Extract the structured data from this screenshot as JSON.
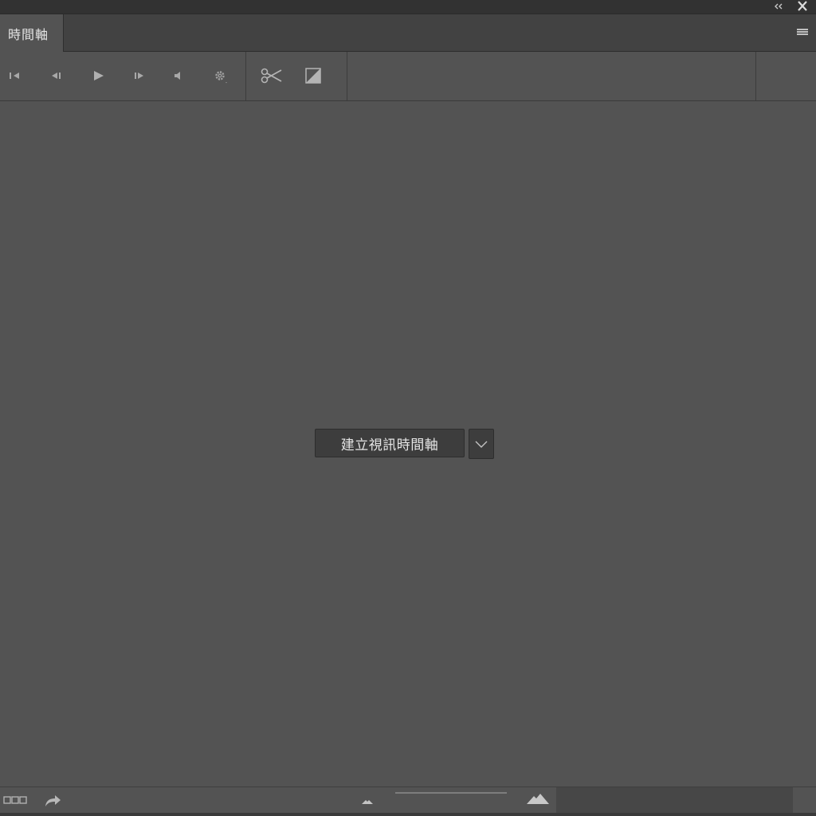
{
  "window": {
    "collapse_icon": "double-chevron-left-icon",
    "close_icon": "close-icon"
  },
  "tab": {
    "label": "時間軸"
  },
  "panel_menu_icon": "hamburger-menu-icon",
  "toolbar": {
    "buttons": [
      {
        "name": "go-to-first-frame",
        "icon": "skip-to-start-icon"
      },
      {
        "name": "previous-frame",
        "icon": "step-back-icon"
      },
      {
        "name": "play",
        "icon": "play-icon"
      },
      {
        "name": "next-frame",
        "icon": "step-forward-icon"
      },
      {
        "name": "audio",
        "icon": "speaker-icon"
      },
      {
        "name": "settings",
        "icon": "gear-icon"
      },
      {
        "name": "split-at-playhead",
        "icon": "scissors-icon"
      },
      {
        "name": "transition",
        "icon": "transition-icon"
      }
    ]
  },
  "create_button": {
    "label": "建立視訊時間軸",
    "dropdown_icon": "chevron-down-icon"
  },
  "bottom_bar": {
    "frames_icon": "frame-animation-icon",
    "convert_icon": "convert-arrow-icon",
    "zoom_out_icon": "small-mountain-icon",
    "zoom_in_icon": "large-mountain-icon",
    "zoom_level": 1.0
  },
  "colors": {
    "panel_bg": "#535353",
    "icon": "#b8b8b8",
    "icon_dim": "#9a9a9a",
    "text": "#e4e4e4"
  }
}
